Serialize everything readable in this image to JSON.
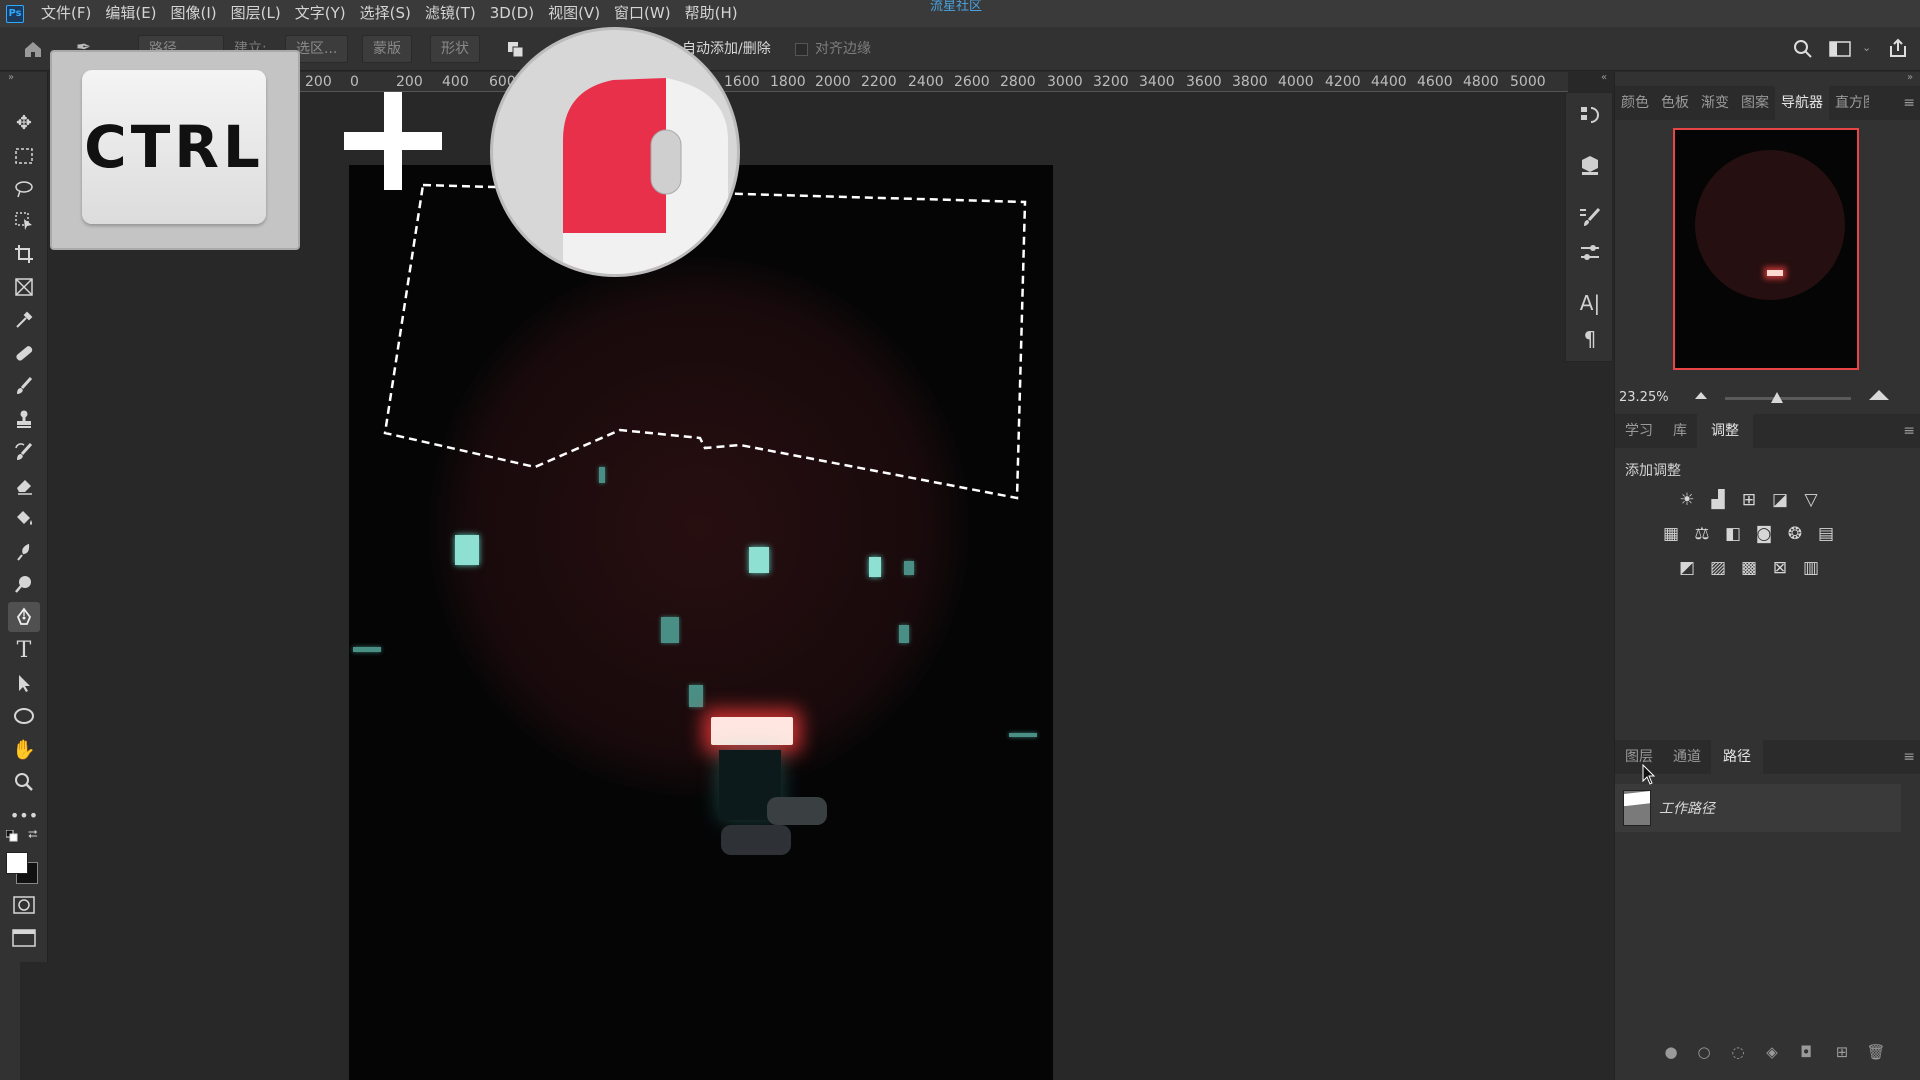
{
  "app": {
    "logo": "Ps",
    "watermark_title": "流星社区"
  },
  "menu": [
    "文件(F)",
    "编辑(E)",
    "图像(I)",
    "图层(L)",
    "文字(Y)",
    "选择(S)",
    "滤镜(T)",
    "3D(D)",
    "视图(V)",
    "窗口(W)",
    "帮助(H)"
  ],
  "options_bar": {
    "mode_value": "路径",
    "make_label": "建立:",
    "selection_button": "选区...",
    "mask_button": "蒙版",
    "shape_button": "形状",
    "auto_add_delete_label": "自动添加/删除",
    "align_edges_label": "对齐边缘"
  },
  "ruler_ticks": [
    "200",
    "0",
    "200",
    "400",
    "600",
    "1600",
    "1800",
    "2000",
    "2200",
    "2400",
    "2600",
    "2800",
    "3000",
    "3200",
    "3400",
    "3600",
    "3800",
    "4000",
    "4200",
    "4400",
    "4600",
    "4800",
    "5000"
  ],
  "overlay": {
    "key_label": "CTRL"
  },
  "right_panels": {
    "top_tabs": [
      "颜色",
      "色板",
      "渐变",
      "图案",
      "导航器",
      "直方图"
    ],
    "top_active_tab": "导航器",
    "zoom_value": "23.25%",
    "mid_tabs": [
      "学习",
      "库",
      "调整"
    ],
    "mid_active_tab": "调整",
    "adjust_title": "添加调整",
    "bottom_tabs": [
      "图层",
      "通道",
      "路径"
    ],
    "bottom_active_tab": "路径",
    "path_item": "工作路径"
  },
  "colors": {
    "ui_bg": "#323232",
    "accent_red": "#e8304a",
    "navigator_border": "#e84545"
  },
  "icons": {
    "toolbar": [
      "move-icon",
      "marquee-icon",
      "lasso-icon",
      "object-select-icon",
      "crop-icon",
      "frame-icon",
      "eyedropper-icon",
      "healing-icon",
      "brush-icon",
      "stamp-icon",
      "history-brush-icon",
      "eraser-icon",
      "bucket-icon",
      "blur-icon",
      "dodge-icon",
      "pen-icon",
      "type-icon",
      "path-select-icon",
      "ellipse-icon",
      "hand-icon",
      "zoom-icon",
      "more-icon"
    ]
  }
}
